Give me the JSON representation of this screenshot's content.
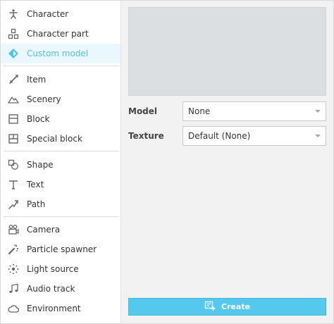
{
  "sidebar": {
    "items": [
      {
        "label": "Character",
        "icon": "character-icon"
      },
      {
        "label": "Character part",
        "icon": "character-part-icon"
      },
      {
        "label": "Custom model",
        "icon": "custom-model-icon",
        "active": true
      },
      {
        "label": "Item",
        "icon": "item-icon"
      },
      {
        "label": "Scenery",
        "icon": "scenery-icon"
      },
      {
        "label": "Block",
        "icon": "block-icon"
      },
      {
        "label": "Special block",
        "icon": "special-block-icon"
      },
      {
        "label": "Shape",
        "icon": "shape-icon"
      },
      {
        "label": "Text",
        "icon": "text-icon"
      },
      {
        "label": "Path",
        "icon": "path-icon"
      },
      {
        "label": "Camera",
        "icon": "camera-icon"
      },
      {
        "label": "Particle spawner",
        "icon": "particle-spawner-icon"
      },
      {
        "label": "Light source",
        "icon": "light-source-icon"
      },
      {
        "label": "Audio track",
        "icon": "audio-track-icon"
      },
      {
        "label": "Environment",
        "icon": "environment-icon"
      }
    ]
  },
  "form": {
    "model_label": "Model",
    "model_value": "None",
    "texture_label": "Texture",
    "texture_value": "Default (None)"
  },
  "create_button": {
    "label": "Create",
    "icon": "create-icon"
  },
  "colors": {
    "accent": "#55c8ee",
    "active_text": "#4fc3e8",
    "active_bg": "#eaf7fc",
    "preview_bg": "#dcdfe1",
    "panel_bg": "#f2f2f2"
  }
}
